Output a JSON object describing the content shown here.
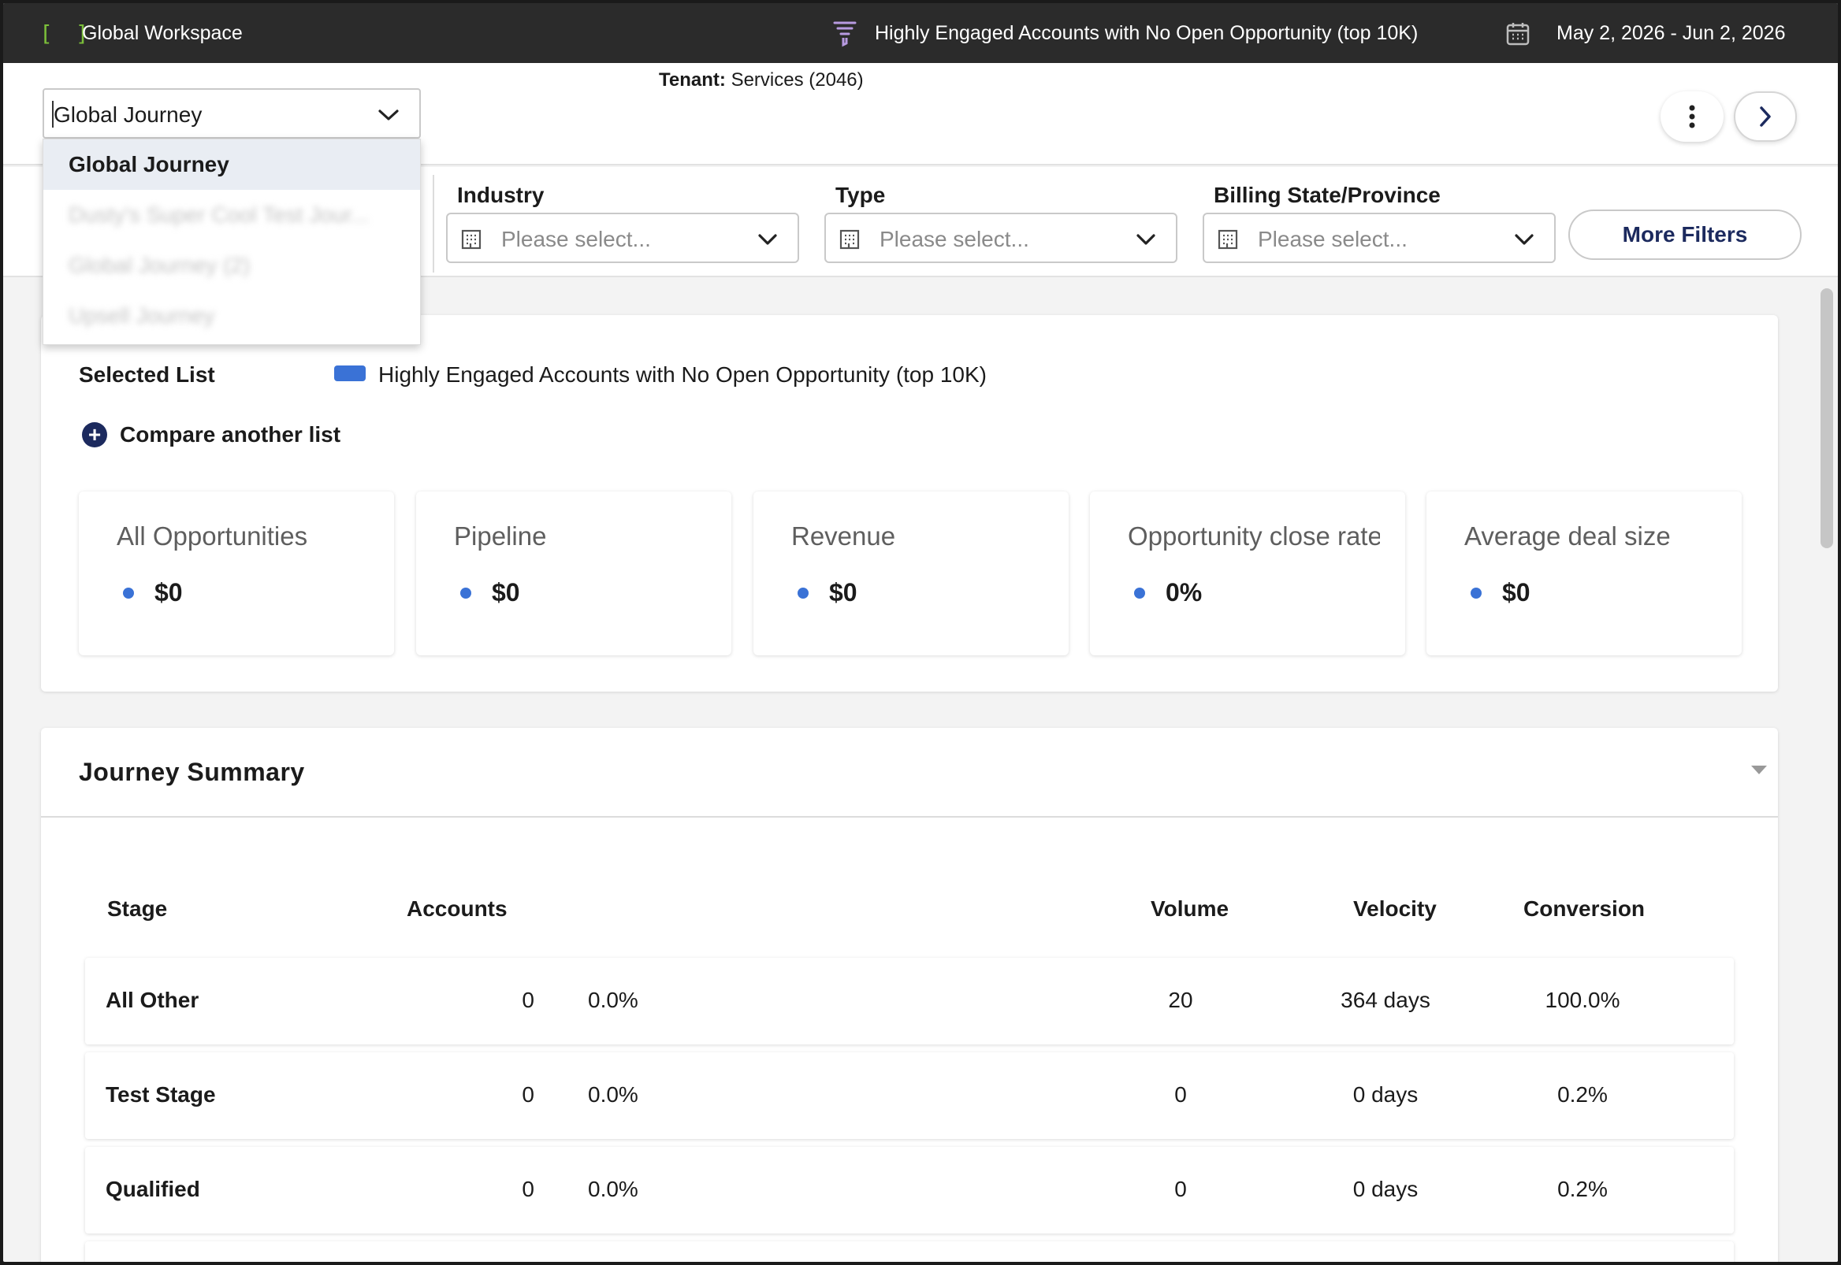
{
  "topbar": {
    "logo_glyph": "[ ]",
    "workspace": "Global Workspace",
    "list_name": "Highly Engaged Accounts with No Open Opportunity (top 10K)",
    "date_range": "May 2, 2026 - Jun 2, 2026",
    "list_icon": "funnel-icon",
    "date_icon": "calendar-icon"
  },
  "header": {
    "tenant_label": "Tenant:",
    "tenant_value": "Services (2046)"
  },
  "journey": {
    "selected": "Global Journey",
    "options": [
      "Global Journey",
      "Dusty's Super Cool Test Jour...",
      "Global Journey (2)",
      "Upsell Journey"
    ]
  },
  "filters": {
    "industry": {
      "label": "Industry",
      "placeholder": "Please select..."
    },
    "type": {
      "label": "Type",
      "placeholder": "Please select..."
    },
    "billing_state": {
      "label": "Billing State/Province",
      "placeholder": "Please select..."
    },
    "more_filters": "More Filters"
  },
  "selected_list": {
    "label": "Selected List",
    "name": "Highly Engaged Accounts with No Open Opportunity (top 10K)",
    "color": "#3a72d6",
    "compare_label": "Compare another list"
  },
  "metrics": [
    {
      "title": "All Opportunities",
      "value": "$0"
    },
    {
      "title": "Pipeline",
      "value": "$0"
    },
    {
      "title": "Revenue",
      "value": "$0"
    },
    {
      "title": "Opportunity close rate",
      "value": "0%"
    },
    {
      "title": "Average deal size",
      "value": "$0"
    }
  ],
  "summary": {
    "title": "Journey Summary",
    "headers": {
      "stage": "Stage",
      "accounts": "Accounts",
      "volume": "Volume",
      "velocity": "Velocity",
      "conversion": "Conversion"
    },
    "rows": [
      {
        "stage": "All Other",
        "accounts": "0",
        "pct": "0.0%",
        "volume": "20",
        "velocity": "364 days",
        "conversion": "100.0%"
      },
      {
        "stage": "Test Stage",
        "accounts": "0",
        "pct": "0.0%",
        "volume": "0",
        "velocity": "0 days",
        "conversion": "0.2%"
      },
      {
        "stage": "Qualified",
        "accounts": "0",
        "pct": "0.0%",
        "volume": "0",
        "velocity": "0 days",
        "conversion": "0.2%"
      }
    ]
  },
  "colors": {
    "topbar_bg": "#2b2b2b",
    "accent_navy": "#1c2a5e",
    "series_blue": "#3a72d6",
    "logo_green": "#7bbf3a"
  }
}
